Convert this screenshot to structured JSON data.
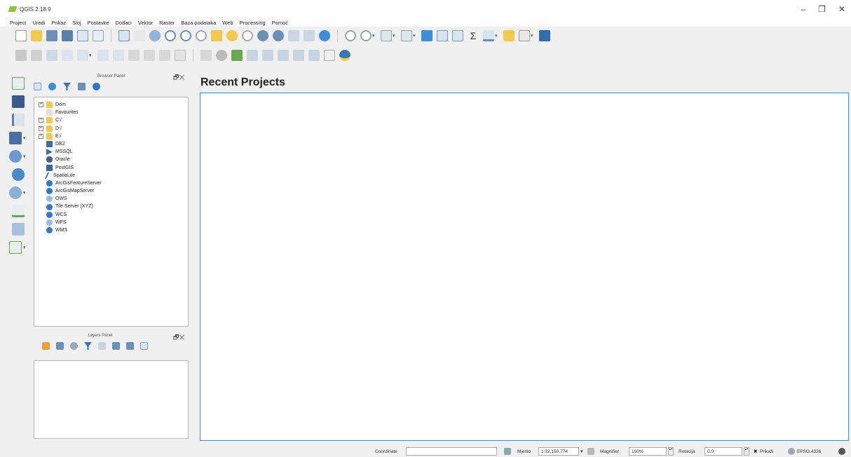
{
  "window": {
    "title": "QGIS 2.18.9",
    "minimize": "–",
    "maximize": "❐",
    "close": "✕"
  },
  "menu": [
    "Project",
    "Uredi",
    "Prikaz",
    "Sloj",
    "Postavke",
    "Dodaci",
    "Vektor",
    "Raster",
    "Baza podataka",
    "Web",
    "Processing",
    "Pomoć"
  ],
  "browser_panel": {
    "title": "Browser Panel",
    "items": [
      {
        "label": "Dom",
        "icon": "folder-icon",
        "expandable": true
      },
      {
        "label": "Favourites",
        "icon": "star-icon",
        "expandable": false
      },
      {
        "label": "C:/",
        "icon": "drive-icon",
        "expandable": true
      },
      {
        "label": "D:/",
        "icon": "drive-icon",
        "expandable": true
      },
      {
        "label": "E:/",
        "icon": "drive-icon",
        "expandable": true
      },
      {
        "label": "DB2",
        "icon": "db2-icon",
        "expandable": false
      },
      {
        "label": "MSSQL",
        "icon": "mssql-icon",
        "expandable": false
      },
      {
        "label": "Oracle",
        "icon": "oracle-icon",
        "expandable": false
      },
      {
        "label": "PostGIS",
        "icon": "postgis-icon",
        "expandable": false
      },
      {
        "label": "SpatiaLite",
        "icon": "spatialite-icon",
        "expandable": false
      },
      {
        "label": "ArcGisFeatureServer",
        "icon": "arcgis-icon",
        "expandable": false
      },
      {
        "label": "ArcGisMapServer",
        "icon": "arcgis-icon",
        "expandable": false
      },
      {
        "label": "OWS",
        "icon": "ows-icon",
        "expandable": false
      },
      {
        "label": "Tile Server (XYZ)",
        "icon": "xyz-icon",
        "expandable": false
      },
      {
        "label": "WCS",
        "icon": "wcs-icon",
        "expandable": false
      },
      {
        "label": "WFS",
        "icon": "wfs-icon",
        "expandable": false
      },
      {
        "label": "WMS",
        "icon": "wms-icon",
        "expandable": false
      }
    ]
  },
  "layers_panel": {
    "title": "Layers Panel"
  },
  "panel_controls": {
    "float": "🗗",
    "close": "✕"
  },
  "main": {
    "title": "Recent Projects"
  },
  "status": {
    "coordinate_label": "Coordinate",
    "coordinate_value": "",
    "scale_label": "Mjerilo",
    "scale_value": "1:32,150,774",
    "magnifier_label": "Magnifier",
    "magnifier_value": "100%",
    "rotation_label": "Rotacija",
    "rotation_value": "0.0",
    "render_label": "Prikaži",
    "crs_label": "EPSG:4326"
  },
  "colors": {
    "accent": "#3a8fd6",
    "folder": "#f2c94c",
    "qgis_green": "#8cc63f"
  }
}
